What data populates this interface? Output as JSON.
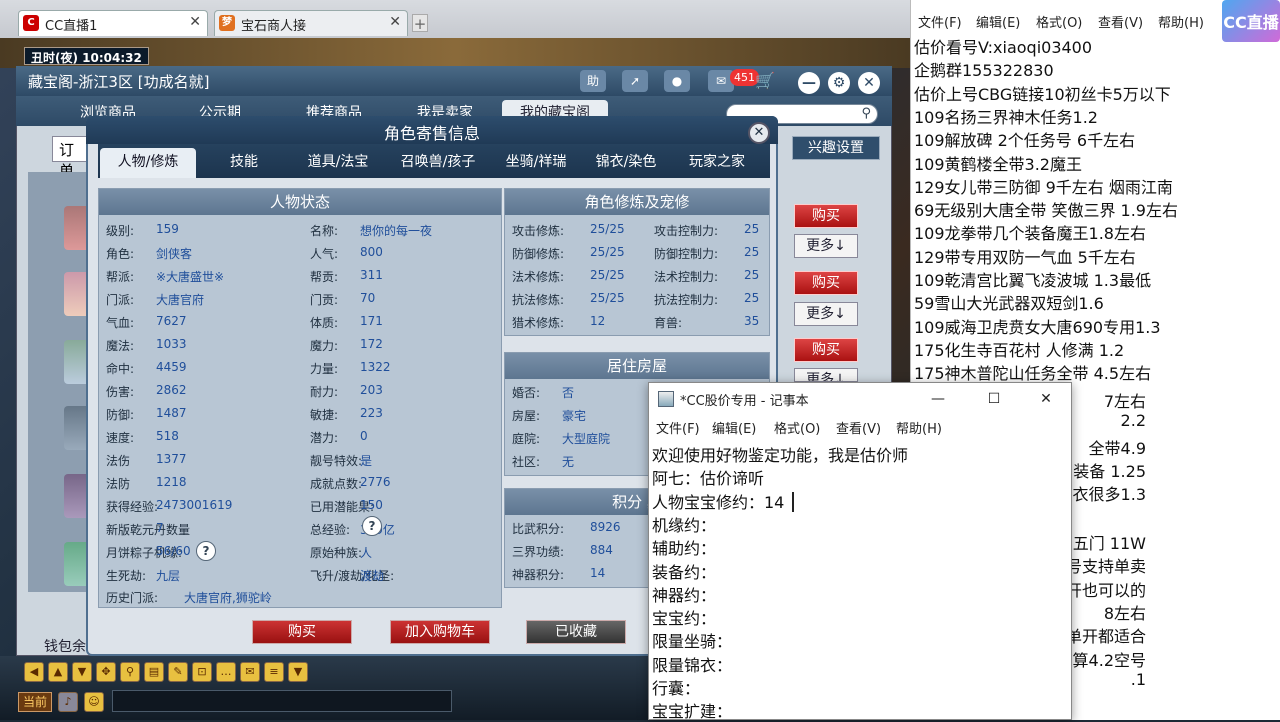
{
  "browser": {
    "tabs": [
      {
        "label": "CC直播1"
      },
      {
        "label": "宝石商人接"
      }
    ]
  },
  "game": {
    "clock": "丑时(夜) 10:04:32",
    "toolbar": {
      "current_label": "当前"
    }
  },
  "market": {
    "title": "藏宝阁-浙江3区 [功成名就]",
    "help_label": "助",
    "cart_count": "451",
    "tabs": [
      "浏览商品",
      "公示期",
      "推荐商品",
      "我是卖家",
      "我的藏宝阁"
    ],
    "order_label": "订单",
    "interest_label": "兴趣设置",
    "buy_label": "购买",
    "more_label": "更多↓",
    "wallet_label": "钱包余"
  },
  "dialog": {
    "title": "角色寄售信息",
    "close": "✕",
    "tabs": [
      "人物/修炼",
      "技能",
      "道具/法宝",
      "召唤兽/孩子",
      "坐骑/祥瑞",
      "锦衣/染色",
      "玩家之家"
    ],
    "status_header": "人物状态",
    "status_left": [
      {
        "label": "级别:",
        "value": "159"
      },
      {
        "label": "角色:",
        "value": "剑侠客"
      },
      {
        "label": "帮派:",
        "value": "※大唐盛世※"
      },
      {
        "label": "门派:",
        "value": "大唐官府"
      },
      {
        "label": "气血:",
        "value": "7627"
      },
      {
        "label": "魔法:",
        "value": "1033"
      },
      {
        "label": "命中:",
        "value": "4459"
      },
      {
        "label": "伤害:",
        "value": "2862"
      },
      {
        "label": "防御:",
        "value": "1487"
      },
      {
        "label": "速度:",
        "value": "518"
      },
      {
        "label": "法伤",
        "value": "1377"
      },
      {
        "label": "法防",
        "value": "1218"
      },
      {
        "label": "获得经验:",
        "value": "2473001619"
      },
      {
        "label": "新版乾元丹数量",
        "value": "7"
      },
      {
        "label": "月饼粽子机缘:",
        "value": "56/60"
      },
      {
        "label": "生死劫:",
        "value": "九层"
      }
    ],
    "status_right": [
      {
        "label": "名称:",
        "value": "想你的每一夜"
      },
      {
        "label": "人气:",
        "value": "800"
      },
      {
        "label": "帮贡:",
        "value": "311"
      },
      {
        "label": "门贡:",
        "value": "70"
      },
      {
        "label": "体质:",
        "value": "171"
      },
      {
        "label": "魔力:",
        "value": "172"
      },
      {
        "label": "力量:",
        "value": "1322"
      },
      {
        "label": "耐力:",
        "value": "203"
      },
      {
        "label": "敏捷:",
        "value": "223"
      },
      {
        "label": "潜力:",
        "value": "0"
      },
      {
        "label": "靓号特效:",
        "value": "是"
      },
      {
        "label": "成就点数:",
        "value": "2776"
      },
      {
        "label": "已用潜能果:",
        "value": "150"
      },
      {
        "label": "总经验:",
        "value": "369亿"
      },
      {
        "label": "原始种族:",
        "value": "人"
      },
      {
        "label": "飞升/渡劫/化圣:",
        "value": "渡劫"
      }
    ],
    "history_label": "历史门派:",
    "history_value": "大唐官府,狮驼岭",
    "cultivation_header": "角色修炼及宠修",
    "cultivation": [
      {
        "label": "攻击修炼:",
        "value": "25/25",
        "label2": "攻击控制力:",
        "value2": "25"
      },
      {
        "label": "防御修炼:",
        "value": "25/25",
        "label2": "防御控制力:",
        "value2": "25"
      },
      {
        "label": "法术修炼:",
        "value": "25/25",
        "label2": "法术控制力:",
        "value2": "25"
      },
      {
        "label": "抗法修炼:",
        "value": "25/25",
        "label2": "抗法控制力:",
        "value2": "25"
      },
      {
        "label": "猎术修炼:",
        "value": "12",
        "label2": "育兽:",
        "value2": "35"
      }
    ],
    "house_header": "居住房屋",
    "house": [
      {
        "label": "婚否:",
        "value": "否"
      },
      {
        "label": "房屋:",
        "value": "豪宅"
      },
      {
        "label": "庭院:",
        "value": "大型庭院"
      },
      {
        "label": "社区:",
        "value": "无"
      }
    ],
    "score_header": "积分 其",
    "score": [
      {
        "label": "比武积分:",
        "value": "8926"
      },
      {
        "label": "三界功绩:",
        "value": "884"
      },
      {
        "label": "神器积分:",
        "value": "14"
      }
    ],
    "buttons": {
      "buy": "购买",
      "cart": "加入购物车",
      "fav": "已收藏"
    }
  },
  "right_notepad": {
    "menu": [
      "文件(F)",
      "编辑(E)",
      "格式(O)",
      "查看(V)",
      "帮助(H)"
    ],
    "logo": "CC直播",
    "lines": [
      "估价看号V:xiaoqi03400",
      "企鹅群155322830",
      "估价上号CBG链接10初丝卡5万以下",
      "109名扬三界神木任务1.2",
      "109解放碑 2个任务号 6千左右",
      "109黄鹤楼全带3.2魔王",
      "129女儿带三防御 9千左右 烟雨江南",
      "69无级别大唐全带  笑傲三界 1.9左右",
      "109龙拳带几个装备魔王1.8左右",
      "129带专用双防一气血 5千左右",
      "109乾清宫比翼飞凌波城 1.3最低",
      "59雪山大光武器双短剑1.6",
      "109威海卫虎贲女大唐690专用1.3",
      "175化生寺百花村 人修满 1.2",
      "175神木普陀山任务全带 4.5左右"
    ],
    "partial_lines": [
      "7左右",
      "2.2",
      "全带4.9",
      "装备  1.25",
      "衣很多1.3",
      "五门 11W",
      "个号支持单卖",
      "单开也可以的",
      "8左右",
      "五开单开都适合",
      "算4.2空号",
      ".1"
    ]
  },
  "notepad": {
    "title": "*CC股价专用 - 记事本",
    "menu": [
      "文件(F)",
      "编辑(E)",
      "格式(O)",
      "查看(V)",
      "帮助(H)"
    ],
    "lines": [
      "欢迎使用好物鉴定功能，我是估价师",
      "阿七：估价谛听",
      "人物宝宝修约：14",
      "机缘约：",
      "辅助约：",
      "装备约：",
      "神器约：",
      "宝宝约：",
      "限量坐骑：",
      "限量锦衣：",
      "行囊：",
      "宝宝扩建："
    ]
  }
}
